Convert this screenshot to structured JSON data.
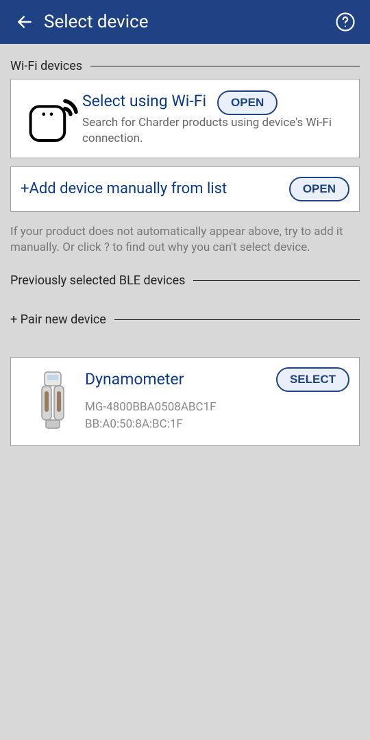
{
  "header": {
    "title": "Select device"
  },
  "sections": {
    "wifi_devices_title": "Wi-Fi devices",
    "previously_title": "Previously selected BLE devices",
    "pair_title": "+ Pair new device"
  },
  "wifi_card": {
    "title": "Select using Wi-Fi",
    "desc": "Search for Charder products using device's Wi-Fi connection.",
    "button": "OPEN"
  },
  "add_card": {
    "title": "+Add device manually from list",
    "button": "OPEN"
  },
  "helper": "If your product does not automatically appear above, try to add it manually. Or click ? to find out why you can't select device.",
  "device": {
    "title": "Dynamometer",
    "id": "MG-4800BBA0508ABC1F",
    "mac": "BB:A0:50:8A:BC:1F",
    "button": "SELECT"
  }
}
